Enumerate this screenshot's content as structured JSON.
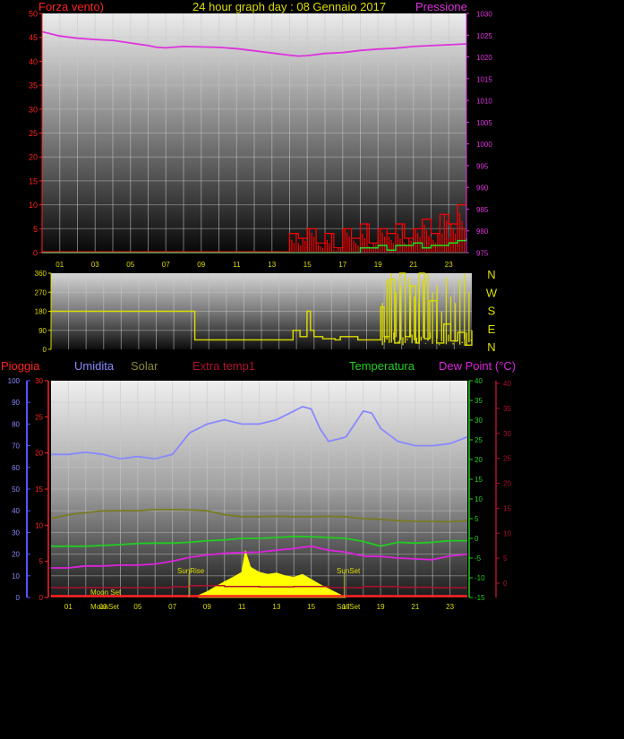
{
  "title": "24 hour graph day : 08 Gennaio 2017",
  "colors": {
    "wind": "#ff0000",
    "gust": "#22dd22",
    "pressure": "#dd33dd",
    "direction": "#dddd00",
    "rain": "#ff2222",
    "humidity": "#8888ff",
    "solar": "#7a7a22",
    "extra_temp": "#b01030",
    "temperature": "#22cc22",
    "dew_point": "#dd22dd",
    "rain_axis": "#5555ff"
  },
  "x_tick_labels": [
    "01",
    "03",
    "05",
    "07",
    "09",
    "11",
    "13",
    "15",
    "17",
    "19",
    "21",
    "23"
  ],
  "chart_data": [
    {
      "type": "line",
      "name": "wind-pressure",
      "left_axis_title": "Forza vento)",
      "right_axis_title": "Pressione",
      "ylim_left": [
        0,
        50
      ],
      "left_ticks": [
        "0",
        "5",
        "10",
        "15",
        "20",
        "25",
        "30",
        "35",
        "40",
        "45",
        "50"
      ],
      "ylim_right": [
        975,
        1030
      ],
      "right_ticks": [
        "975",
        "980",
        "985",
        "990",
        "995",
        "1000",
        "1005",
        "1010",
        "1015",
        "1020",
        "1025",
        "1030"
      ],
      "series": [
        {
          "key": "pressure",
          "x": [
            0,
            1,
            2,
            3,
            4,
            5,
            6,
            6.5,
            7,
            8,
            9,
            10,
            11,
            12,
            13,
            14,
            14.5,
            15,
            16,
            17,
            18,
            19,
            20,
            21,
            22,
            23,
            24
          ],
          "values": [
            1025.8,
            1024.8,
            1024.3,
            1024,
            1023.8,
            1023.2,
            1022.6,
            1022.2,
            1022.1,
            1022.4,
            1022.3,
            1022.2,
            1021.9,
            1021.4,
            1020.9,
            1020.4,
            1020.2,
            1020.3,
            1020.8,
            1021,
            1021.5,
            1021.8,
            1022,
            1022.4,
            1022.6,
            1022.8,
            1023
          ]
        },
        {
          "key": "wind",
          "x": [
            0,
            13.5,
            14,
            14.5,
            15,
            15.5,
            16,
            16.5,
            17,
            17.5,
            18,
            18.5,
            19,
            19.5,
            20,
            20.5,
            21,
            21.5,
            22,
            22.5,
            23,
            23.5,
            24
          ],
          "values": [
            0,
            0,
            4,
            3,
            5,
            2,
            4,
            1,
            5,
            3,
            6,
            2,
            5,
            4,
            6,
            3,
            5,
            7,
            4,
            8,
            6,
            10,
            14
          ]
        },
        {
          "key": "gust",
          "x": [
            0,
            17,
            18,
            19,
            19.5,
            20,
            21,
            21.5,
            22,
            23,
            23.5,
            24
          ],
          "values": [
            0,
            0,
            1,
            1.5,
            0.5,
            1.5,
            2,
            1,
            1.5,
            2,
            2.5,
            3
          ]
        }
      ]
    },
    {
      "type": "line",
      "name": "wind-direction",
      "ylim": [
        0,
        360
      ],
      "y_ticks": [
        "0",
        "90",
        "180",
        "270",
        "360"
      ],
      "compass_labels": [
        "N",
        "W",
        "S",
        "E",
        "N"
      ],
      "series": [
        {
          "key": "direction",
          "x": [
            0,
            8.2,
            8.2,
            13.8,
            13.8,
            14.2,
            14.5,
            14.6,
            14.8,
            15,
            15.5,
            16,
            16.2,
            16.5,
            17.5,
            18.8,
            18.8,
            19,
            19.3,
            19.6,
            19.9,
            20.2,
            20.5,
            20.8,
            21,
            21.3,
            21.6,
            22,
            22.4,
            22.8,
            23.2,
            23.6,
            24
          ],
          "values": [
            180,
            180,
            45,
            45,
            90,
            60,
            60,
            180,
            90,
            60,
            50,
            50,
            45,
            60,
            45,
            45,
            200,
            60,
            330,
            30,
            360,
            60,
            300,
            30,
            360,
            50,
            230,
            30,
            120,
            40,
            80,
            20,
            90
          ]
        }
      ]
    },
    {
      "type": "line",
      "name": "multi-sensor",
      "legend": [
        "Pioggia",
        "Umidita",
        "Solar",
        "Extra temp1",
        "Temperatura",
        "Dew Point (°C)"
      ],
      "humidity_axis": {
        "ylim": [
          0,
          100
        ],
        "ticks": [
          "0",
          "10",
          "20",
          "30",
          "40",
          "50",
          "60",
          "70",
          "80",
          "90",
          "100"
        ]
      },
      "rain_axis": {
        "ylim": [
          0,
          30
        ],
        "ticks": [
          "0",
          "5",
          "10",
          "15",
          "20",
          "25",
          "30"
        ]
      },
      "temperature_axis": {
        "ylim": [
          -15,
          40
        ],
        "ticks": [
          "-15",
          "-10",
          "-5",
          "0",
          "5",
          "10",
          "15",
          "20",
          "25",
          "30",
          "35",
          "40"
        ]
      },
      "dew_axis": {
        "ylim": [
          -3,
          40
        ],
        "ticks": [
          "0",
          "5",
          "10",
          "15",
          "20",
          "25",
          "30",
          "35",
          "40"
        ]
      },
      "series": [
        {
          "key": "humidity",
          "x": [
            0,
            1,
            2,
            3,
            4,
            5,
            6,
            7,
            8,
            9,
            10,
            11,
            12,
            13,
            14,
            14.5,
            15,
            15.5,
            16,
            17,
            18,
            18.5,
            19,
            20,
            21,
            22,
            23,
            24
          ],
          "values": [
            66,
            66,
            67,
            66,
            64,
            65,
            64,
            66,
            76,
            80,
            82,
            80,
            80,
            82,
            86,
            88,
            87,
            78,
            72,
            74,
            86,
            85,
            78,
            72,
            70,
            70,
            71,
            74
          ]
        },
        {
          "key": "solar",
          "x": [
            0,
            1,
            2,
            3,
            4,
            5,
            6,
            7,
            8,
            9,
            10,
            11,
            12,
            13,
            14,
            15,
            16,
            17,
            18,
            19,
            20,
            21,
            22,
            23,
            24
          ],
          "values": [
            5,
            6,
            6.5,
            7,
            7,
            7,
            7.3,
            7.3,
            7.2,
            7,
            6,
            5.5,
            5.5,
            5.6,
            5.5,
            5.5,
            5.6,
            5.5,
            5,
            4.8,
            4.5,
            4.3,
            4.3,
            4.2,
            4.5
          ]
        },
        {
          "key": "temperature",
          "x": [
            0,
            1,
            2,
            3,
            4,
            5,
            6,
            7,
            8,
            9,
            10,
            11,
            12,
            13,
            14,
            15,
            16,
            17,
            18,
            19,
            20,
            21,
            22,
            23,
            24
          ],
          "values": [
            -2,
            -2,
            -2,
            -1.8,
            -1.6,
            -1.3,
            -1.2,
            -1.2,
            -1,
            -0.6,
            -0.4,
            0,
            0,
            0.2,
            0.5,
            0.4,
            0.2,
            0,
            -0.8,
            -2,
            -1,
            -1.2,
            -1,
            -0.6,
            -0.6
          ]
        },
        {
          "key": "dew_point",
          "x": [
            0,
            1,
            2,
            3,
            4,
            5,
            6,
            7,
            8,
            9,
            10,
            11,
            12,
            13,
            14,
            15,
            16,
            17,
            18,
            19,
            20,
            21,
            22,
            23,
            24
          ],
          "values": [
            -7.5,
            -7.5,
            -7,
            -7,
            -6.8,
            -6.8,
            -6.5,
            -5.8,
            -4.8,
            -4.2,
            -3.8,
            -3.6,
            -3.5,
            -3,
            -2.6,
            -2,
            -3,
            -3.5,
            -4.5,
            -4.6,
            -5,
            -5.2,
            -5.4,
            -4.5,
            -4
          ]
        },
        {
          "key": "extra_temp",
          "x": [
            0,
            6,
            7,
            8,
            10,
            12,
            14,
            16,
            18,
            20,
            22,
            24
          ],
          "values": [
            -12.5,
            -12.5,
            -12.3,
            -12,
            -12.2,
            -12.3,
            -12.2,
            -12.5,
            -12.2,
            -12.4,
            -12.5,
            -12.5
          ]
        },
        {
          "key": "solar_radiation",
          "x": [
            8.5,
            9,
            9.5,
            10,
            10.5,
            11,
            11.2,
            11.5,
            12,
            12.5,
            13,
            13.5,
            14,
            14.5,
            15,
            15.5,
            16,
            16.5,
            17
          ],
          "values": [
            0.3,
            0.8,
            1.5,
            2.2,
            2.8,
            3.5,
            6.5,
            4.2,
            3.5,
            3.2,
            3.4,
            3.0,
            2.8,
            3.2,
            2.5,
            1.8,
            1.2,
            0.6,
            0
          ]
        }
      ],
      "annotations": [
        "SunRise",
        "SunSet",
        "Moon Set",
        "MoonSet",
        "SunSet"
      ]
    }
  ]
}
